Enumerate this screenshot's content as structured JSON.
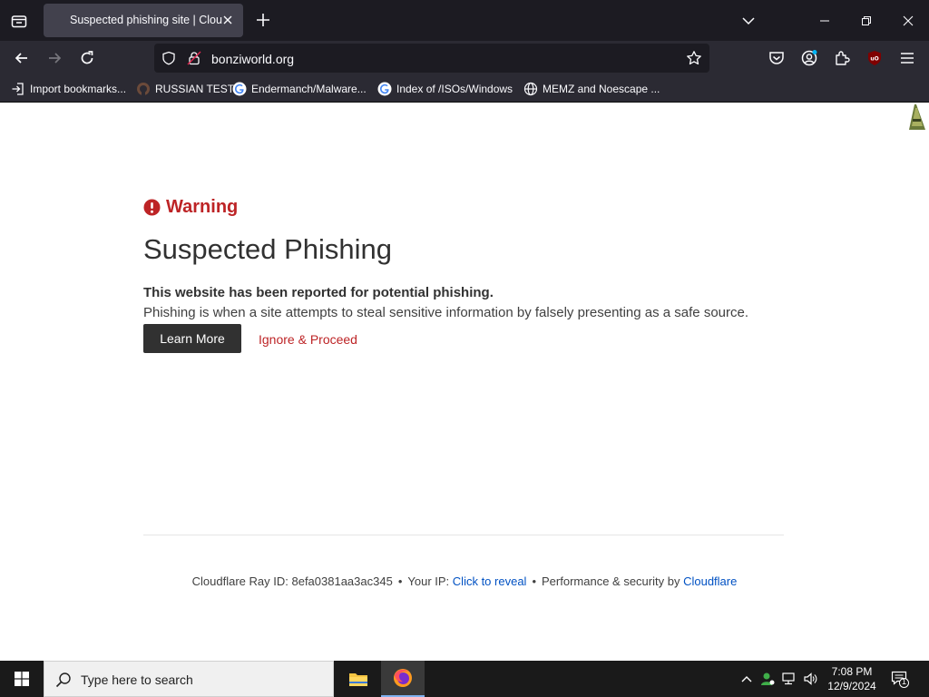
{
  "browser": {
    "tab_title": "Suspected phishing site | Cloudflare",
    "url": "bonziworld.org",
    "bookmarks": [
      {
        "label": "Import bookmarks...",
        "icon": "import-icon"
      },
      {
        "label": "RUSSIAN TEST",
        "icon": "site-favicon"
      },
      {
        "label": "Endermanch/Malware...",
        "icon": "google-icon"
      },
      {
        "label": "Index of /ISOs/Windows",
        "icon": "google-icon"
      },
      {
        "label": "MEMZ and Noescape ...",
        "icon": "globe-icon"
      }
    ]
  },
  "page": {
    "warning_label": "Warning",
    "title": "Suspected Phishing",
    "subtitle": "This website has been reported for potential phishing.",
    "description": "Phishing is when a site attempts to steal sensitive information by falsely presenting as a safe source.",
    "learn_more": "Learn More",
    "ignore_proceed": "Ignore & Proceed",
    "footer": {
      "ray_label": "Cloudflare Ray ID:",
      "ray_id": "8efa0381aa3ac345",
      "ip_label": "Your IP:",
      "ip_link": "Click to reveal",
      "perf_label": "Performance & security by",
      "perf_link": "Cloudflare"
    }
  },
  "taskbar": {
    "search_placeholder": "Type here to search",
    "time": "7:08 PM",
    "date": "12/9/2024",
    "notification_count": "1"
  },
  "colors": {
    "warning_red": "#bd2426",
    "link_blue": "#0051c3",
    "browser_dark": "#1c1b22"
  }
}
